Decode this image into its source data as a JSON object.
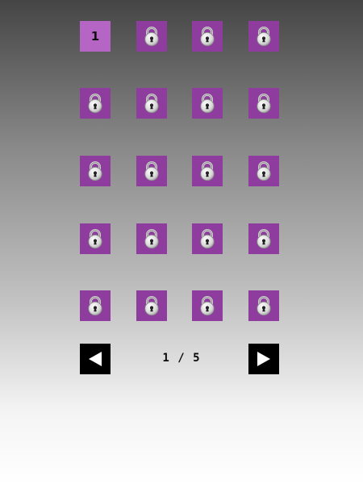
{
  "levels": [
    {
      "label": "1",
      "state": "unlocked",
      "icon": "number"
    },
    {
      "label": "",
      "state": "locked",
      "icon": "lock-icon"
    },
    {
      "label": "",
      "state": "locked",
      "icon": "lock-icon"
    },
    {
      "label": "",
      "state": "locked",
      "icon": "lock-icon"
    },
    {
      "label": "",
      "state": "locked",
      "icon": "lock-icon"
    },
    {
      "label": "",
      "state": "locked",
      "icon": "lock-icon"
    },
    {
      "label": "",
      "state": "locked",
      "icon": "lock-icon"
    },
    {
      "label": "",
      "state": "locked",
      "icon": "lock-icon"
    },
    {
      "label": "",
      "state": "locked",
      "icon": "lock-icon"
    },
    {
      "label": "",
      "state": "locked",
      "icon": "lock-icon"
    },
    {
      "label": "",
      "state": "locked",
      "icon": "lock-icon"
    },
    {
      "label": "",
      "state": "locked",
      "icon": "lock-icon"
    },
    {
      "label": "",
      "state": "locked",
      "icon": "lock-icon"
    },
    {
      "label": "",
      "state": "locked",
      "icon": "lock-icon"
    },
    {
      "label": "",
      "state": "locked",
      "icon": "lock-icon"
    },
    {
      "label": "",
      "state": "locked",
      "icon": "lock-icon"
    },
    {
      "label": "",
      "state": "locked",
      "icon": "lock-icon"
    },
    {
      "label": "",
      "state": "locked",
      "icon": "lock-icon"
    },
    {
      "label": "",
      "state": "locked",
      "icon": "lock-icon"
    },
    {
      "label": "",
      "state": "locked",
      "icon": "lock-icon"
    }
  ],
  "pagination": {
    "current": 1,
    "total": 5,
    "indicator": "1 / 5",
    "prev_icon": "arrow-left-icon",
    "next_icon": "arrow-right-icon"
  },
  "colors": {
    "tile_locked": "#8e3d9e",
    "tile_unlocked": "#b565c3",
    "nav_button": "#000000"
  }
}
